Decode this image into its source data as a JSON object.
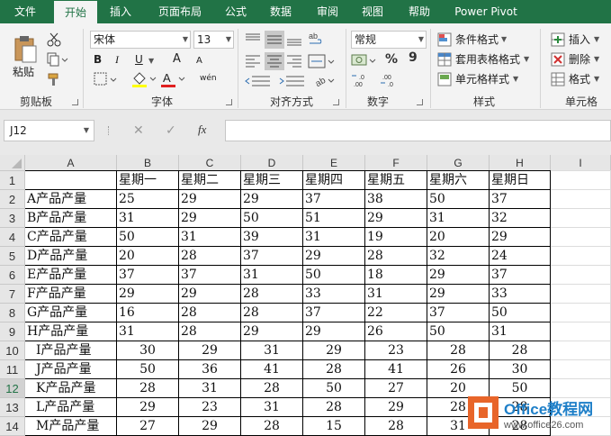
{
  "tabs": [
    "文件",
    "开始",
    "插入",
    "页面布局",
    "公式",
    "数据",
    "审阅",
    "视图",
    "帮助",
    "Power Pivot"
  ],
  "active_tab": "开始",
  "ribbon": {
    "groups": [
      "剪贴板",
      "字体",
      "对齐方式",
      "数字",
      "样式",
      "单元格"
    ],
    "clipboard": {
      "paste": "粘贴"
    },
    "font": {
      "name": "宋体",
      "size": "13",
      "bold": "B",
      "italic": "I",
      "underline": "U",
      "grow": "A",
      "shrink": "A",
      "phonetic": "wén"
    },
    "number": {
      "format": "常规",
      "percent": "%",
      "comma": "9"
    },
    "styles": {
      "conditional": "条件格式",
      "table": "套用表格格式",
      "cell": "单元格样式"
    },
    "cells": {
      "insert": "插入",
      "delete": "删除",
      "format": "格式"
    }
  },
  "formula_bar": {
    "name_box": "J12",
    "cancel": "✕",
    "enter": "✓",
    "fx": "fx",
    "formula": ""
  },
  "sheet": {
    "columns": [
      "A",
      "B",
      "C",
      "D",
      "E",
      "F",
      "G",
      "H",
      "I"
    ],
    "rows": [
      "1",
      "2",
      "3",
      "4",
      "5",
      "6",
      "7",
      "8",
      "9",
      "10",
      "11",
      "12",
      "13",
      "14"
    ],
    "selected_row": "12",
    "header": [
      "",
      "星期一",
      "星期二",
      "星期三",
      "星期四",
      "星期五",
      "星期六",
      "星期日"
    ],
    "data": [
      [
        "A产品产量",
        "25",
        "29",
        "29",
        "37",
        "38",
        "50",
        "37"
      ],
      [
        "B产品产量",
        "31",
        "29",
        "50",
        "51",
        "29",
        "31",
        "32"
      ],
      [
        "C产品产量",
        "50",
        "31",
        "39",
        "31",
        "19",
        "20",
        "29"
      ],
      [
        "D产品产量",
        "20",
        "28",
        "37",
        "29",
        "28",
        "32",
        "24"
      ],
      [
        "E产品产量",
        "37",
        "37",
        "31",
        "50",
        "18",
        "29",
        "37"
      ],
      [
        "F产品产量",
        "29",
        "29",
        "28",
        "33",
        "31",
        "29",
        "33"
      ],
      [
        "G产品产量",
        "16",
        "28",
        "28",
        "37",
        "22",
        "37",
        "50"
      ],
      [
        "H产品产量",
        "31",
        "28",
        "29",
        "29",
        "26",
        "50",
        "31"
      ],
      [
        "I产品产量",
        "30",
        "29",
        "31",
        "29",
        "23",
        "28",
        "28"
      ],
      [
        "J产品产量",
        "50",
        "36",
        "41",
        "28",
        "41",
        "26",
        "30"
      ],
      [
        "K产品产量",
        "28",
        "31",
        "28",
        "50",
        "27",
        "20",
        "50"
      ],
      [
        "L产品产量",
        "29",
        "23",
        "31",
        "28",
        "29",
        "28",
        "28"
      ],
      [
        "M产品产量",
        "27",
        "29",
        "28",
        "15",
        "28",
        "31",
        "28"
      ]
    ]
  },
  "watermark": {
    "brand": "Office教程网",
    "url": "www.office26.com"
  }
}
